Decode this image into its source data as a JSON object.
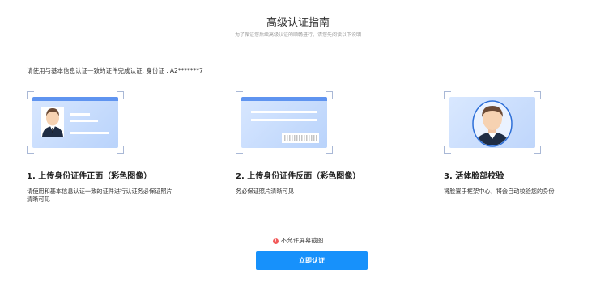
{
  "header": {
    "title": "高级认证指南",
    "subtitle": "为了保证您后续高级认证的顺畅进行，请您先阅读以下说明"
  },
  "intro": {
    "text": "请使用与基本信息认证一致的证件完成认证: 身份证 :",
    "id_value": "A2*******7"
  },
  "steps": [
    {
      "title": "1. 上传身份证件正面（彩色图像）",
      "description": "请使用和基本信息认证一致的证件进行认证务必保证照片清晰可见",
      "illustration": "id-card-front"
    },
    {
      "title": "2. 上传身份证件反面（彩色图像）",
      "description": "务必保证照片清晰可见",
      "illustration": "id-card-back"
    },
    {
      "title": "3. 活体脸部校验",
      "description": "将脸置于框架中心，将会自动校验您的身份",
      "illustration": "face-scan"
    }
  ],
  "notice": {
    "icon": "warning-icon",
    "text": "不允许屏幕截图"
  },
  "actions": {
    "start_label": "立即认证"
  },
  "colors": {
    "primary": "#1791fb",
    "card_band": "#5f94f0",
    "card_bg": "#c6dcfb",
    "warning": "#f25a5a",
    "frame_corner": "#a9b8d6"
  }
}
